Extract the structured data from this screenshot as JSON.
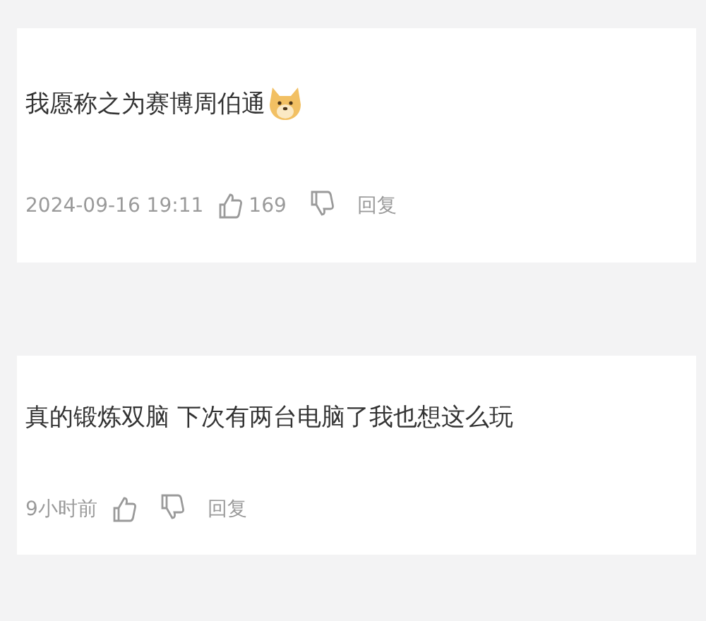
{
  "comments": [
    {
      "text": "我愿称之为赛博周伯通",
      "emoji": true,
      "time": "2024-09-16 19:11",
      "likes": "169",
      "reply": "回复"
    },
    {
      "text": "真的锻炼双脑 下次有两台电脑了我也想这么玩",
      "emoji": false,
      "time": "9小时前",
      "reply": "回复"
    }
  ]
}
